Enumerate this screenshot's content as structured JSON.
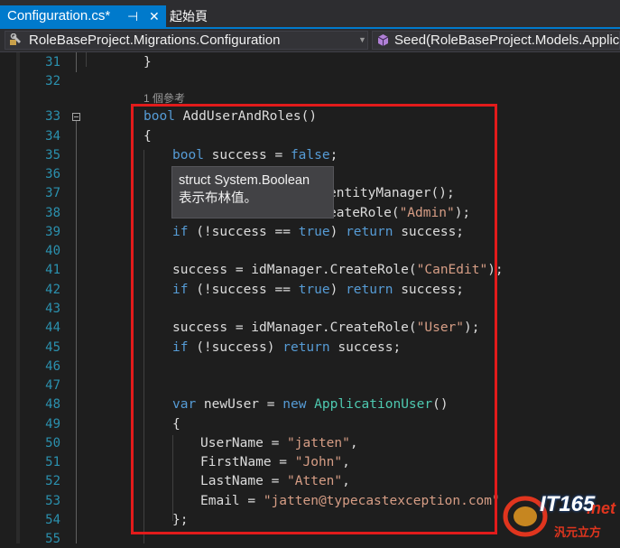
{
  "tabs": {
    "active_label": "Configuration.cs*",
    "pin_glyph": "⊣",
    "close_glyph": "✕",
    "second_label": "起始頁"
  },
  "navbar": {
    "left_label": "RoleBaseProject.Migrations.Configuration",
    "right_label": "Seed(RoleBaseProject.Models.Applic"
  },
  "editor": {
    "line_numbers": [
      "31",
      "32",
      "33",
      "34",
      "35",
      "36",
      "37",
      "38",
      "39",
      "40",
      "41",
      "42",
      "43",
      "44",
      "45",
      "46",
      "47",
      "48",
      "49",
      "50",
      "51",
      "52",
      "53",
      "54",
      "55"
    ],
    "codelens": "1 個參考",
    "code": {
      "l31": "}",
      "l33_kw": "bool",
      "l33_rest": " AddUserAndRoles()",
      "l34": "{",
      "l35_kw": "bool",
      "l35_mid": " success = ",
      "l35_kw2": "false",
      "l35_end": ";",
      "l37_tail": "entityManager();",
      "l38_tail": "eateRole(",
      "l38_str": "\"Admin\"",
      "l38_end": ");",
      "l39_kw": "if",
      "l39_mid": " (!success == ",
      "l39_kw2": "true",
      "l39_mid2": ") ",
      "l39_kw3": "return",
      "l39_end": " success;",
      "l41_pre": "success = idManager.CreateRole(",
      "l41_str": "\"CanEdit\"",
      "l41_end": ");",
      "l42_kw": "if",
      "l42_mid": " (!success == ",
      "l42_kw2": "true",
      "l42_mid2": ") ",
      "l42_kw3": "return",
      "l42_end": " success;",
      "l44_pre": "success = idManager.CreateRole(",
      "l44_str": "\"User\"",
      "l44_end": ");",
      "l45_kw": "if",
      "l45_mid": " (!success) ",
      "l45_kw2": "return",
      "l45_end": " success;",
      "l48_kw": "var",
      "l48_mid": " newUser = ",
      "l48_kw2": "new",
      "l48_sp": " ",
      "l48_ty": "ApplicationUser",
      "l48_end": "()",
      "l49": "{",
      "l50_pre": "UserName = ",
      "l50_str": "\"jatten\"",
      "l50_end": ",",
      "l51_pre": "FirstName = ",
      "l51_str": "\"John\"",
      "l51_end": ",",
      "l52_pre": "LastName = ",
      "l52_str": "\"Atten\"",
      "l52_end": ",",
      "l53_pre": "Email = ",
      "l53_str": "\"jatten@typecastexception.com\"",
      "l54": "};"
    }
  },
  "tooltip": {
    "line1": "struct System.Boolean",
    "line2": "表示布林值。"
  },
  "watermark": {
    "brand": "IT165",
    "dot": ".net",
    "sub": "汎元立方"
  },
  "colors": {
    "accent": "#007acc",
    "keyword": "#569cd6",
    "type": "#4ec9b0",
    "string": "#d69d85",
    "highlight": "#e21b1b"
  }
}
